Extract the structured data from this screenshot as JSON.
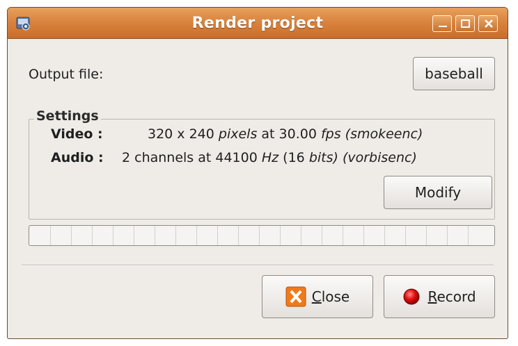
{
  "window": {
    "title": "Render project",
    "app_icon": "render-app-icon",
    "controls": [
      "minimize-icon",
      "maximize-icon",
      "close-icon"
    ]
  },
  "output": {
    "label": "Output file:",
    "file_button": "baseball"
  },
  "settings": {
    "title": "Settings",
    "video_label": "Video :",
    "video_value": "320 x 240 pixels at 30.00 fps (smokeenc)",
    "audio_label": "Audio :",
    "audio_value": "2 channels at 44100 Hz (16 bits) (vorbisenc)",
    "modify_button": "Modify"
  },
  "progress": {
    "value": 0
  },
  "footer": {
    "close_button": "Close",
    "record_button": "Record"
  },
  "colors": {
    "titlebar": "#d9843f",
    "window_bg": "#efebe7",
    "close_icon": "#f07a1a",
    "record_icon": "#d40000"
  }
}
